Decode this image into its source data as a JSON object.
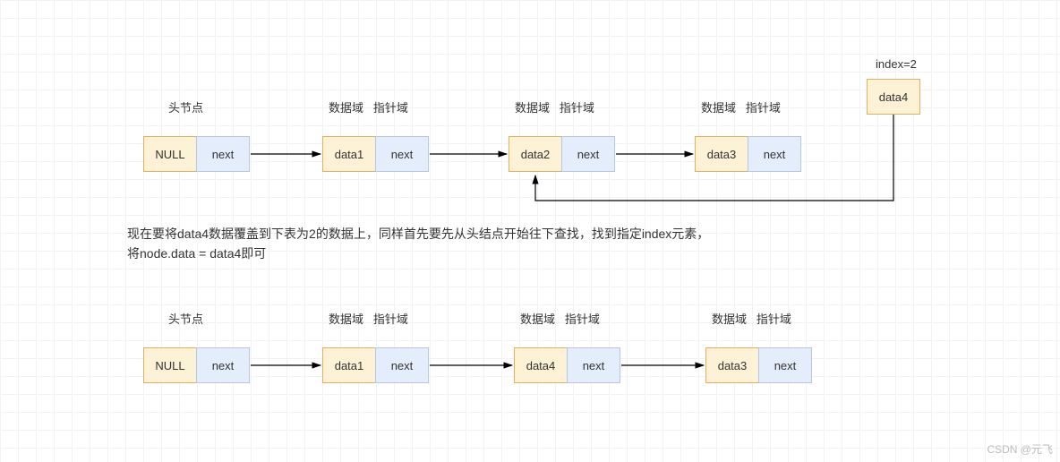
{
  "labels": {
    "head": "头节点",
    "dataField": "数据域",
    "ptrField": "指针域",
    "index": "index=2"
  },
  "row1": {
    "nodes": [
      {
        "data": "NULL",
        "next": "next"
      },
      {
        "data": "data1",
        "next": "next"
      },
      {
        "data": "data2",
        "next": "next"
      },
      {
        "data": "data3",
        "next": "next"
      }
    ]
  },
  "newNode": {
    "data": "data4"
  },
  "description": {
    "line1": "现在要将data4数据覆盖到下表为2的数据上，同样首先要先从头结点开始往下查找，找到指定index元素，",
    "line2": "将node.data = data4即可"
  },
  "row2": {
    "nodes": [
      {
        "data": "NULL",
        "next": "next"
      },
      {
        "data": "data1",
        "next": "next"
      },
      {
        "data": "data4",
        "next": "next"
      },
      {
        "data": "data3",
        "next": "next"
      }
    ]
  },
  "watermark": "CSDN @元飞"
}
